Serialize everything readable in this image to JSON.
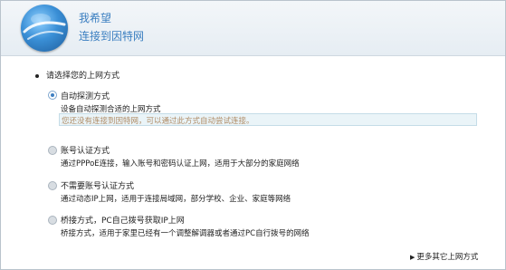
{
  "header": {
    "title": "我希望",
    "subtitle": "连接到因特网",
    "logo_icon": "globe-icon"
  },
  "prompt": "请选择您的上网方式",
  "options": [
    {
      "title": "自动探测方式",
      "desc": "设备自动探测合适的上网方式",
      "selected": true
    },
    {
      "title": "账号认证方式",
      "desc": "通过PPPoE连接，输入账号和密码认证上网，适用于大部分的家庭网络",
      "selected": false
    },
    {
      "title": "不需要账号认证方式",
      "desc": "通过动态IP上网，适用于连接局域网，部分学校、企业、家庭等网络",
      "selected": false
    },
    {
      "title": "桥接方式，PC自己拨号获取IP上网",
      "desc": "桥接方式，适用于家里已经有一个调整解调器或者通过PC自行拨号的网络",
      "selected": false
    }
  ],
  "hint": "您还没有连接到因特网，可以通过此方式自动尝试连接。",
  "more_link": "更多其它上网方式",
  "colors": {
    "accent": "#3a7ec0",
    "hint_text": "#b08c66",
    "hint_bg": "#eaf4f8"
  }
}
